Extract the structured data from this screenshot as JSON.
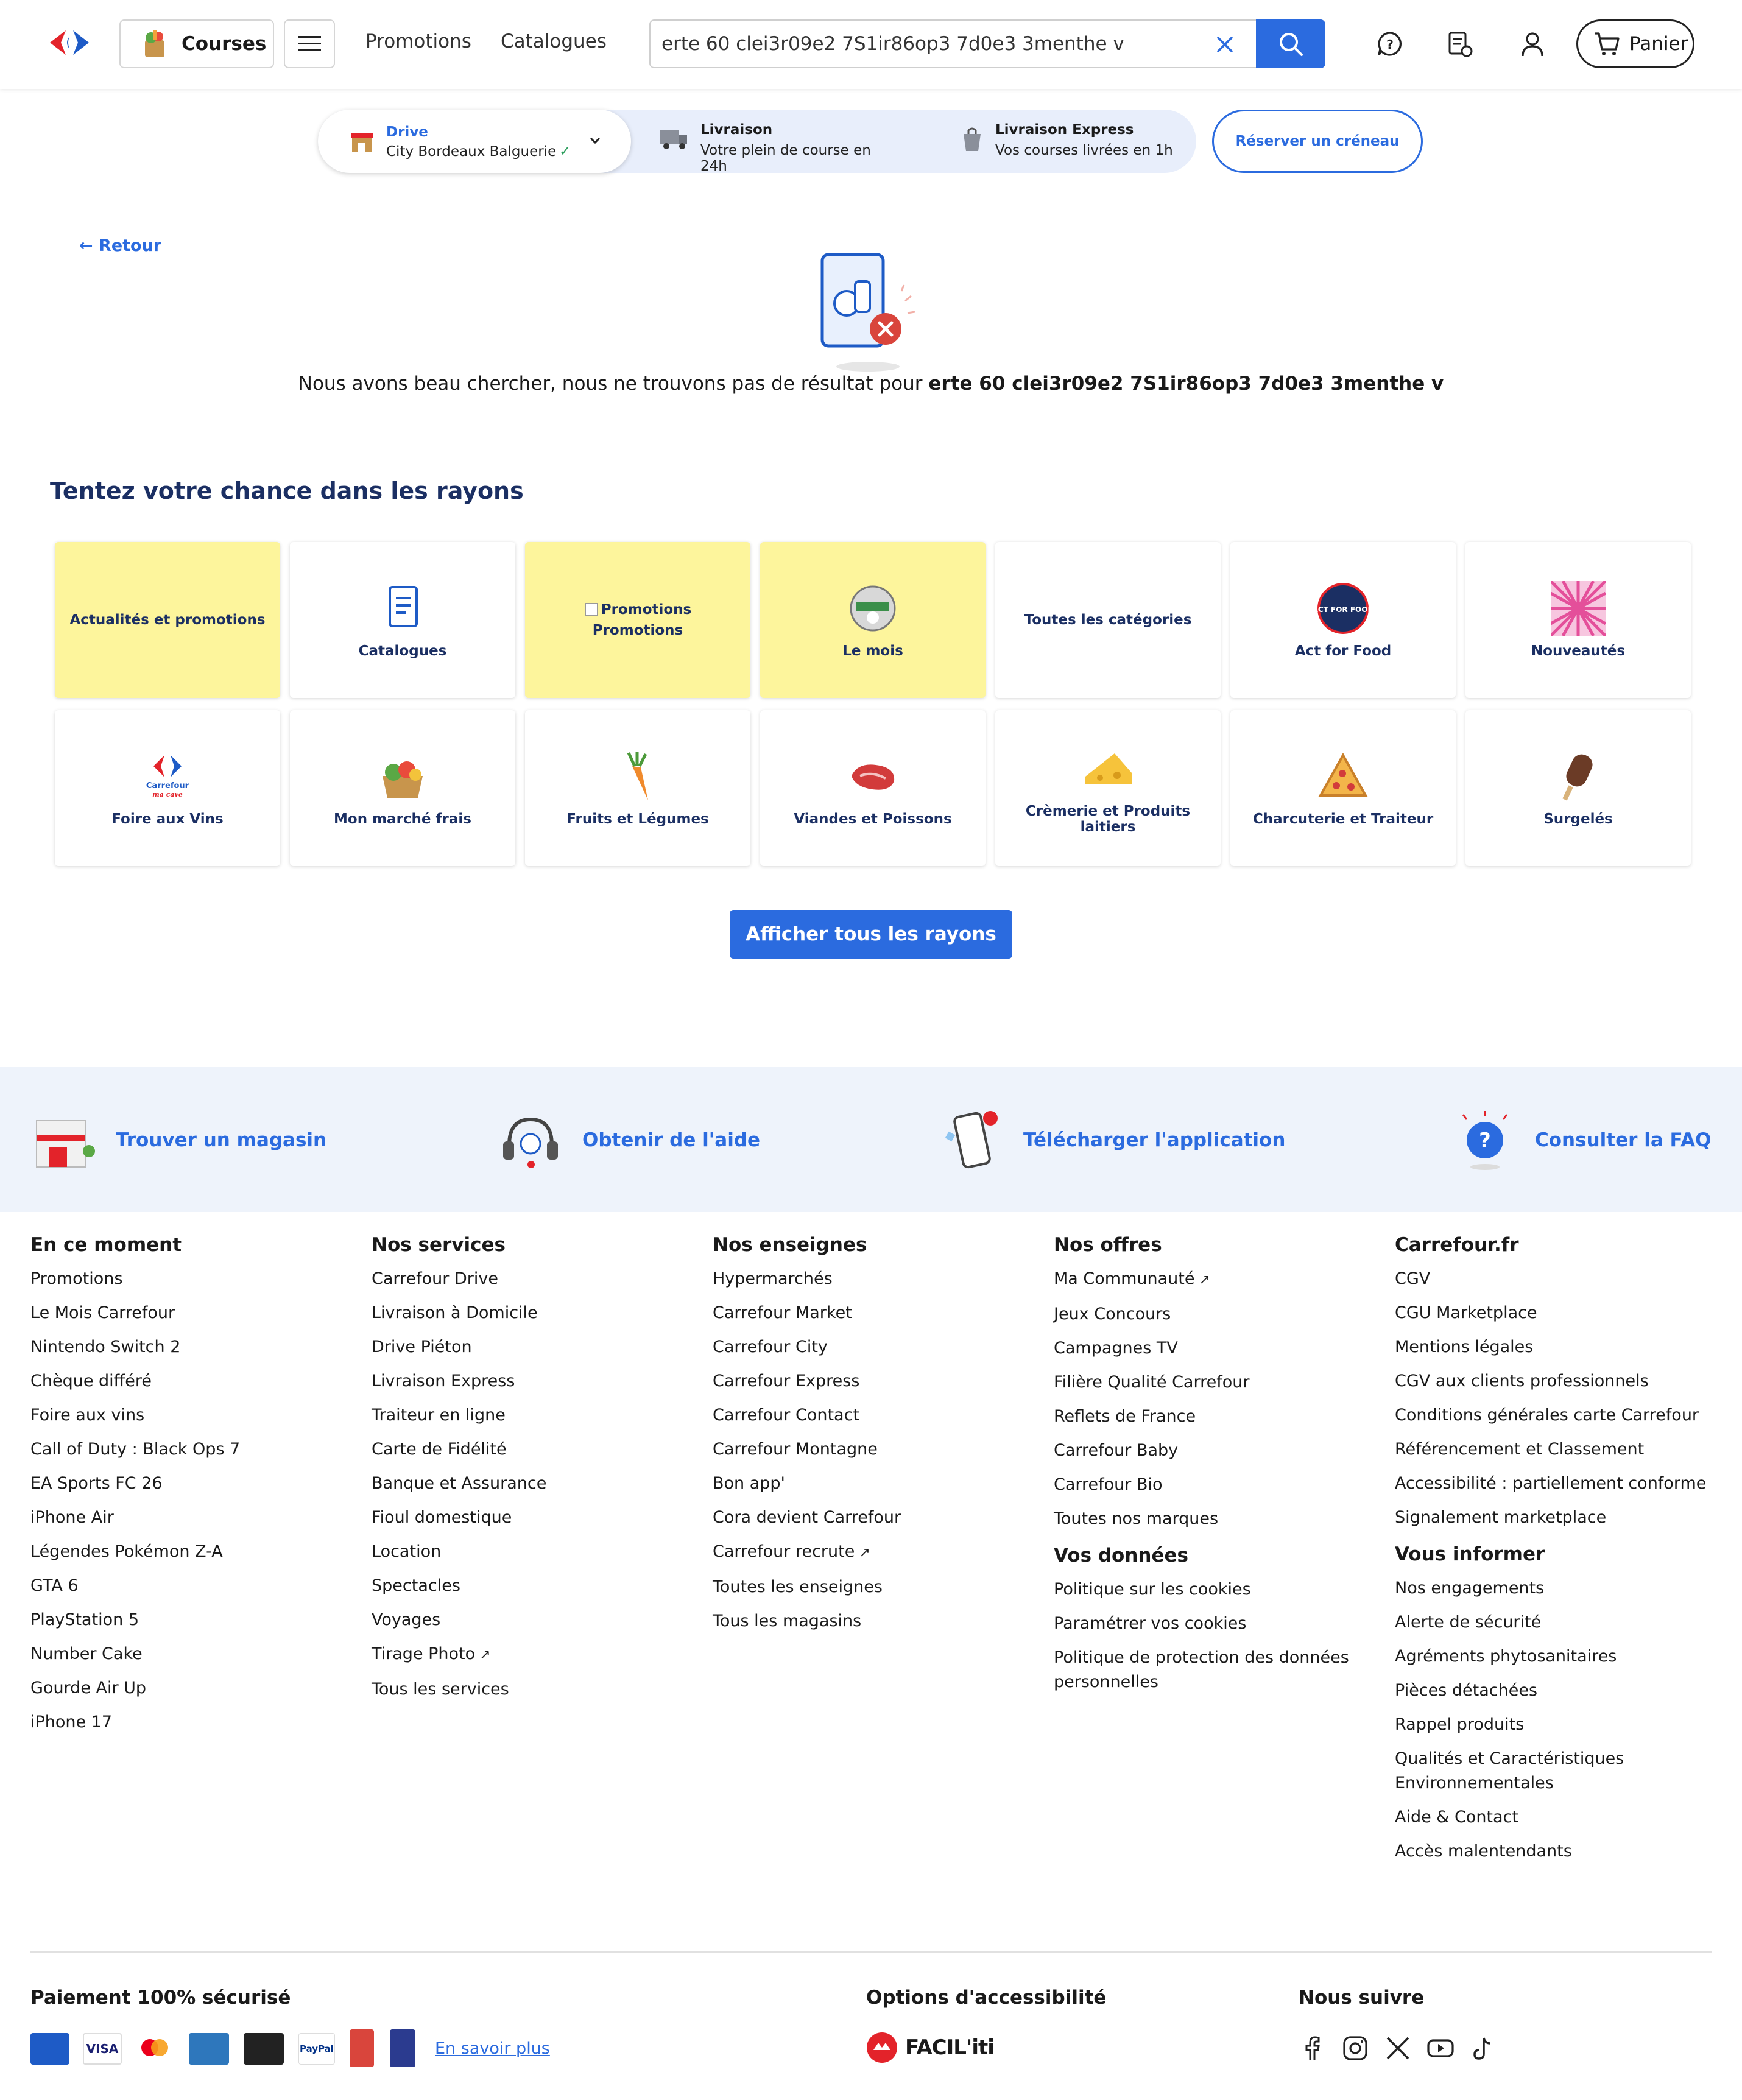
{
  "header": {
    "courses_label": "Courses",
    "nav": [
      "Promotions",
      "Catalogues"
    ],
    "search_value": "erte 60 clei3r09e2 7S1ir86op3 7d0e3 3menthe v",
    "cart_label": "Panier"
  },
  "delivery": {
    "drive_title": "Drive",
    "drive_store": "City Bordeaux Balguerie",
    "livraison_title": "Livraison",
    "livraison_sub": "Votre plein de course en 24h",
    "express_title": "Livraison Express",
    "express_sub": "Vos courses livrées en 1h",
    "reserve_label": "Réserver un créneau"
  },
  "main": {
    "back_label": "Retour",
    "noresult_prefix": "Nous avons beau chercher, nous ne trouvons pas de résultat pour ",
    "noresult_query": "erte 60 clei3r09e2 7S1ir86op3 7d0e3 3menthe v",
    "section_title": "Tentez votre chance dans les rayons",
    "tiles": [
      {
        "label": "Actualités et promotions",
        "highlight": true,
        "icon": "none"
      },
      {
        "label": "Catalogues",
        "highlight": false,
        "icon": "catalogue-icon"
      },
      {
        "label": "Promotions",
        "alt": "Promotions",
        "highlight": true,
        "icon": "broken-image-icon"
      },
      {
        "label": "Le mois",
        "highlight": true,
        "icon": "le-mois-badge-icon"
      },
      {
        "label": "Toutes les catégories",
        "highlight": false,
        "icon": "none"
      },
      {
        "label": "Act for Food",
        "highlight": false,
        "icon": "act-for-food-logo"
      },
      {
        "label": "Nouveautés",
        "highlight": false,
        "icon": "sunburst-icon"
      },
      {
        "label": "Foire aux Vins",
        "highlight": false,
        "icon": "carrefour-ma-cave-logo"
      },
      {
        "label": "Mon marché frais",
        "highlight": false,
        "icon": "vegetable-basket-icon"
      },
      {
        "label": "Fruits et Légumes",
        "highlight": false,
        "icon": "carrot-icon"
      },
      {
        "label": "Viandes et Poissons",
        "highlight": false,
        "icon": "meat-icon"
      },
      {
        "label": "Crèmerie et Produits laitiers",
        "highlight": false,
        "icon": "cheese-icon"
      },
      {
        "label": "Charcuterie et Traiteur",
        "highlight": false,
        "icon": "pizza-icon"
      },
      {
        "label": "Surgelés",
        "highlight": false,
        "icon": "ice-cream-icon"
      }
    ],
    "tile_logo_text": {
      "ma_cave_brand": "Carrefour",
      "ma_cave_sub": "ma cave",
      "act_for_food": "ACT FOR FOOD"
    },
    "show_all_label": "Afficher tous les rayons"
  },
  "help": [
    {
      "label": "Trouver un magasin",
      "icon": "store-icon"
    },
    {
      "label": "Obtenir de l'aide",
      "icon": "headset-icon"
    },
    {
      "label": "Télécharger l'application",
      "icon": "mobile-app-icon"
    },
    {
      "label": "Consulter la FAQ",
      "icon": "faq-bubble-icon"
    }
  ],
  "footer": {
    "col1": {
      "title": "En ce moment",
      "links": [
        "Promotions",
        "Le Mois Carrefour",
        "Nintendo Switch 2",
        "Chèque différé",
        "Foire aux vins",
        "Call of Duty : Black Ops 7",
        "EA Sports FC 26",
        "iPhone Air",
        "Légendes Pokémon Z-A",
        "GTA 6",
        "PlayStation 5",
        "Number Cake",
        "Gourde Air Up",
        "iPhone 17"
      ]
    },
    "col2": {
      "title": "Nos services",
      "links": [
        "Carrefour Drive",
        "Livraison à Domicile",
        "Drive Piéton",
        "Livraison Express",
        "Traiteur en ligne",
        "Carte de Fidélité",
        "Banque et Assurance",
        "Fioul domestique",
        "Location",
        "Spectacles",
        "Voyages",
        "Tirage Photo",
        "Tous les services"
      ]
    },
    "col3": {
      "title": "Nos enseignes",
      "links": [
        "Hypermarchés",
        "Carrefour Market",
        "Carrefour City",
        "Carrefour Express",
        "Carrefour Contact",
        "Carrefour Montagne",
        "Bon app'",
        "Cora devient Carrefour",
        "Carrefour recrute",
        "Toutes les enseignes",
        "Tous les magasins"
      ]
    },
    "col4": {
      "title": "Nos offres",
      "links": [
        "Ma Communauté",
        "Jeux Concours",
        "Campagnes TV",
        "Filière Qualité Carrefour",
        "Reflets de France",
        "Carrefour Baby",
        "Carrefour Bio",
        "Toutes nos marques"
      ],
      "title2": "Vos données",
      "links2": [
        "Politique sur les cookies",
        "Paramétrer vos cookies",
        "Politique de protection des données personnelles"
      ]
    },
    "col5": {
      "title": "Carrefour.fr",
      "links": [
        "CGV",
        "CGU Marketplace",
        "Mentions légales",
        "CGV aux clients professionnels",
        "Conditions générales carte Carrefour",
        "Référencement et Classement",
        "Accessibilité : partiellement conforme",
        "Signalement marketplace"
      ],
      "title2": "Vous informer",
      "links2": [
        "Nos engagements",
        "Alerte de sécurité",
        "Agréments phytosanitaires",
        "Pièces détachées",
        "Rappel produits",
        "Qualités et Caractéristiques Environnementales",
        "Aide & Contact",
        "Accès malentendants"
      ]
    },
    "external_links": [
      "Ma Communauté",
      "Tirage Photo",
      "Carrefour recrute"
    ],
    "bottom": {
      "payment_title": "Paiement 100% sécurisé",
      "payment_logos": {
        "visa": "VISA",
        "paypal": "PayPal"
      },
      "payment_link": "En savoir plus",
      "accessibility_title": "Options d'accessibilité",
      "faciliti_label": "FACIL'iti",
      "follow_title": "Nous suivre",
      "socials": [
        "facebook-icon",
        "instagram-icon",
        "x-icon",
        "youtube-icon",
        "tiktok-icon"
      ]
    }
  },
  "colors": {
    "brand_blue": "#2b6bdf",
    "navy": "#1b2f63",
    "highlight_yellow": "#fdf59c",
    "band": "#eef3fb"
  }
}
